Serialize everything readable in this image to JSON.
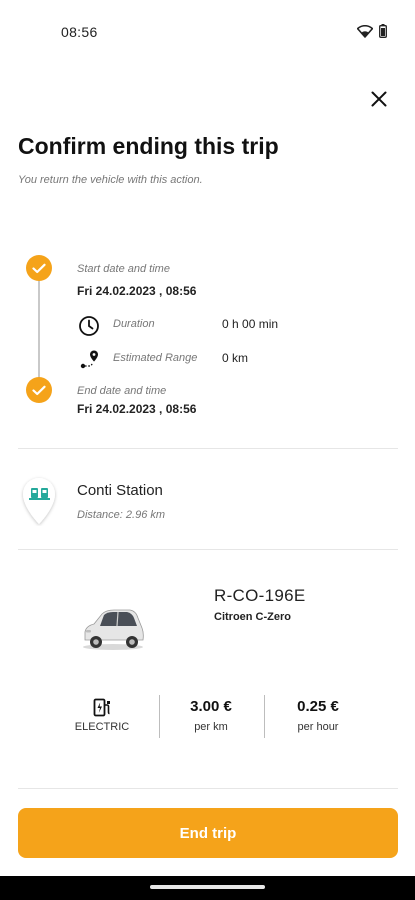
{
  "status_bar": {
    "time": "08:56",
    "icons": [
      "wifi-icon",
      "battery-icon"
    ]
  },
  "header": {
    "close_icon": "close-icon",
    "title": "Confirm ending this trip",
    "subtitle": "You return the vehicle with this action."
  },
  "timeline": {
    "start_label": "Start date and time",
    "start_value": "Fri 24.02.2023 , 08:56",
    "duration_label": "Duration",
    "duration_value": "0 h 00 min",
    "range_label": "Estimated Range",
    "range_value": "0 km",
    "end_label": "End date and time",
    "end_value": "Fri 24.02.2023 , 08:56"
  },
  "station": {
    "name": "Conti Station",
    "distance": "Distance: 2.96 km",
    "icon": "charging-station-pin-icon"
  },
  "vehicle": {
    "plate": "R-CO-196E",
    "model": "Citroen C-Zero",
    "specs": [
      {
        "value": "",
        "label": "ELECTRIC",
        "icon": "ev-charging-icon"
      },
      {
        "value": "3.00 €",
        "label": "per km"
      },
      {
        "value": "0.25 €",
        "label": "per hour"
      }
    ]
  },
  "actions": {
    "end_trip_label": "End trip"
  },
  "colors": {
    "accent": "#f5a31a",
    "station_teal": "#25a99b"
  }
}
